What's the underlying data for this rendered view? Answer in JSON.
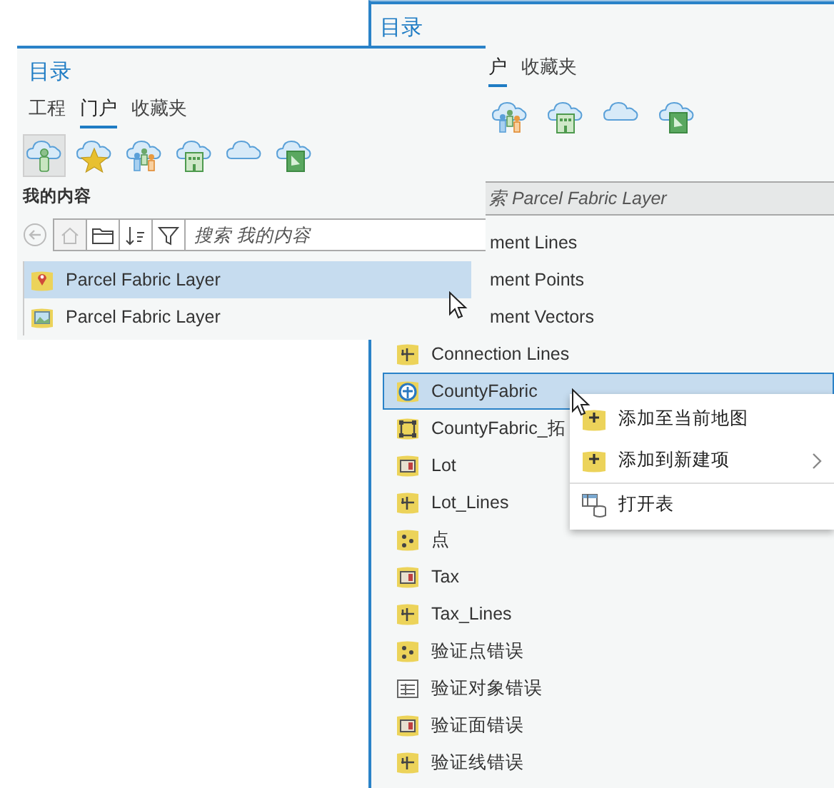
{
  "right_panel": {
    "title": "目录",
    "tabs": [
      {
        "label": "户",
        "selected": true
      },
      {
        "label": "收藏夹",
        "selected": false
      }
    ],
    "portal_icons": [
      {
        "kind": "groups",
        "selected": false
      },
      {
        "kind": "organization",
        "selected": false
      },
      {
        "kind": "portal",
        "selected": false
      },
      {
        "kind": "living-atlas",
        "selected": false
      }
    ],
    "search": {
      "value": "索 Parcel Fabric Layer"
    },
    "items": [
      {
        "name": "ment Lines",
        "kind": "clipped",
        "selected": false
      },
      {
        "name": "ment Points",
        "kind": "clipped",
        "selected": false
      },
      {
        "name": "ment Vectors",
        "kind": "clipped",
        "selected": false
      },
      {
        "name": "Connection Lines",
        "kind": "line",
        "selected": false
      },
      {
        "name": "CountyFabric",
        "kind": "parcel-fabric",
        "selected": true
      },
      {
        "name": "CountyFabric_拓",
        "kind": "topology",
        "selected": false
      },
      {
        "name": "Lot",
        "kind": "polygon",
        "selected": false
      },
      {
        "name": "Lot_Lines",
        "kind": "line",
        "selected": false
      },
      {
        "name": "点",
        "kind": "point",
        "selected": false
      },
      {
        "name": "Tax",
        "kind": "polygon",
        "selected": false
      },
      {
        "name": "Tax_Lines",
        "kind": "line",
        "selected": false
      },
      {
        "name": "验证点错误",
        "kind": "point",
        "selected": false
      },
      {
        "name": "验证对象错误",
        "kind": "table",
        "selected": false
      },
      {
        "name": "验证面错误",
        "kind": "polygon",
        "selected": false
      },
      {
        "name": "验证线错误",
        "kind": "line",
        "selected": false
      }
    ]
  },
  "context_menu": [
    {
      "label": "添加至当前地图",
      "kind": "add",
      "submenu": false,
      "divider_before": false
    },
    {
      "label": "添加到新建项",
      "kind": "add",
      "submenu": true,
      "divider_before": false
    },
    {
      "label": "打开表",
      "kind": "table",
      "submenu": false,
      "divider_before": true
    }
  ],
  "left_panel": {
    "title": "目录",
    "tabs": [
      {
        "label": "工程",
        "selected": false
      },
      {
        "label": "门户",
        "selected": true
      },
      {
        "label": "收藏夹",
        "selected": false
      }
    ],
    "portal_icons": [
      {
        "kind": "my-content",
        "selected": true
      },
      {
        "kind": "favorites",
        "selected": false
      },
      {
        "kind": "groups",
        "selected": false
      },
      {
        "kind": "organization",
        "selected": false
      },
      {
        "kind": "portal",
        "selected": false
      },
      {
        "kind": "living-atlas",
        "selected": false
      }
    ],
    "section": "我的内容",
    "search": {
      "placeholder": "搜索 我的内容"
    },
    "items": [
      {
        "name": "Parcel Fabric Layer",
        "kind": "pin-layer",
        "selected": true
      },
      {
        "name": "Parcel Fabric Layer",
        "kind": "image-layer",
        "selected": false
      }
    ]
  }
}
